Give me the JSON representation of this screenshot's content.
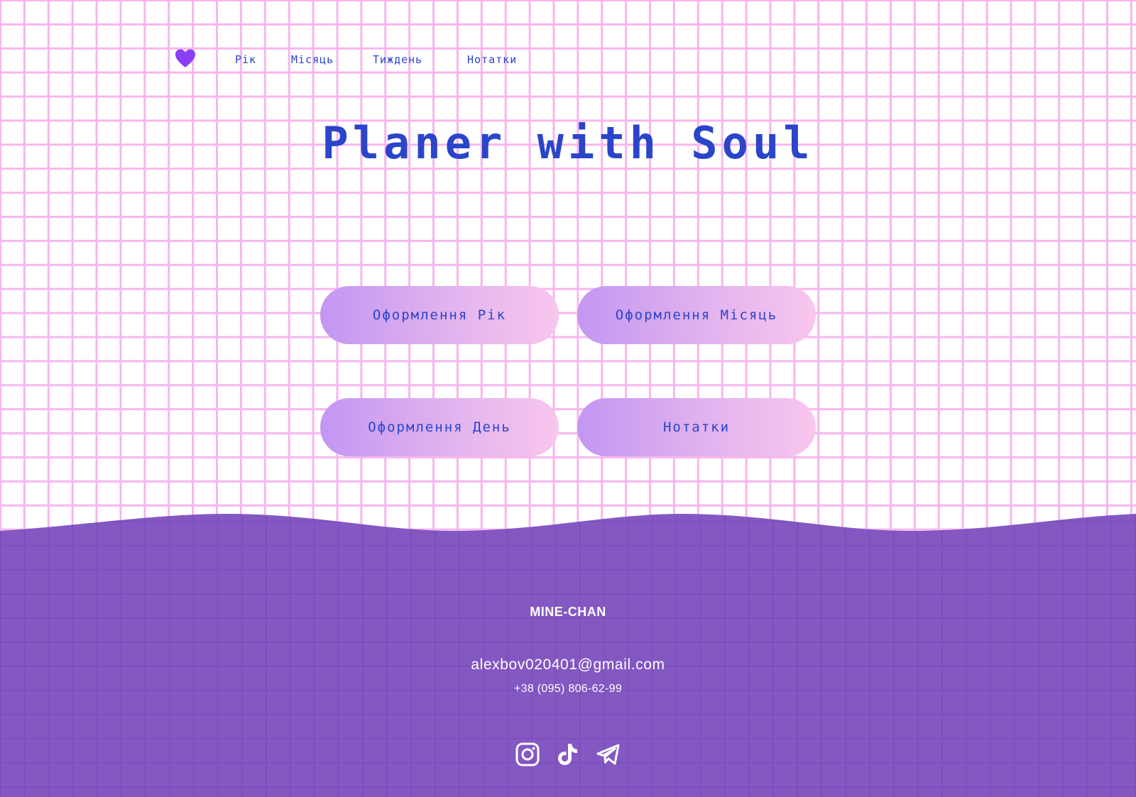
{
  "nav": {
    "logo_icon": "heart-icon",
    "links": [
      {
        "label": "Рік"
      },
      {
        "label": "Місяць"
      },
      {
        "label": "Тиждень"
      },
      {
        "label": "Нотатки"
      }
    ]
  },
  "hero": {
    "title": "Planer with Soul"
  },
  "buttons": [
    {
      "label": "Оформлення Рік"
    },
    {
      "label": "Оформлення Місяць"
    },
    {
      "label": "Оформлення День"
    },
    {
      "label": "Нотатки"
    }
  ],
  "footer": {
    "brand": "MINE-CHAN",
    "email": "alexbov020401@gmail.com",
    "phone": "+38 (095) 806-62-99",
    "socials": [
      {
        "icon": "instagram-icon"
      },
      {
        "icon": "tiktok-icon"
      },
      {
        "icon": "telegram-icon"
      }
    ]
  },
  "colors": {
    "grid_line": "#f7b6ee",
    "accent_text": "#2a45c9",
    "logo": "#8a3ff7",
    "footer_bg": "#8458c2",
    "button_gradient_start": "#c396f2",
    "button_gradient_end": "#f9c6ee"
  }
}
